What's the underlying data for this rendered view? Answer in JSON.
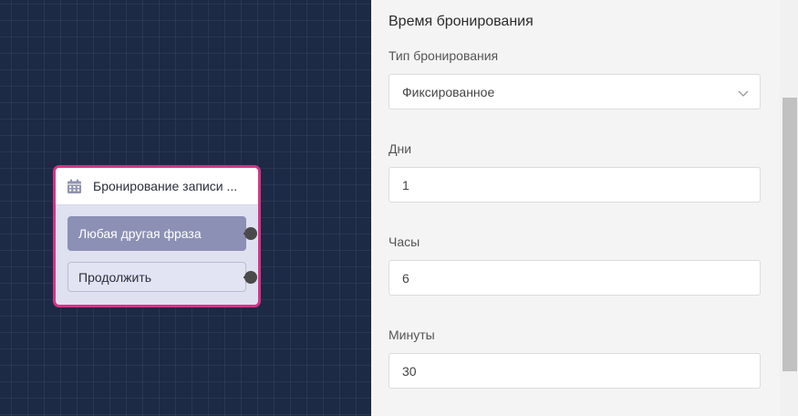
{
  "node": {
    "title": "Бронирование записи ...",
    "options": [
      "Любая другая фраза",
      "Продолжить"
    ]
  },
  "panel": {
    "section_title": "Время бронирования",
    "booking_type": {
      "label": "Тип бронирования",
      "value": "Фиксированное"
    },
    "days": {
      "label": "Дни",
      "value": "1"
    },
    "hours": {
      "label": "Часы",
      "value": "6"
    },
    "minutes": {
      "label": "Минуты",
      "value": "30"
    }
  },
  "colors": {
    "canvas_bg": "#1c2a45",
    "node_border": "#d63384",
    "option_selected_bg": "#8c90b5"
  },
  "icons": [
    "calendar-icon",
    "chevron-down-icon"
  ]
}
